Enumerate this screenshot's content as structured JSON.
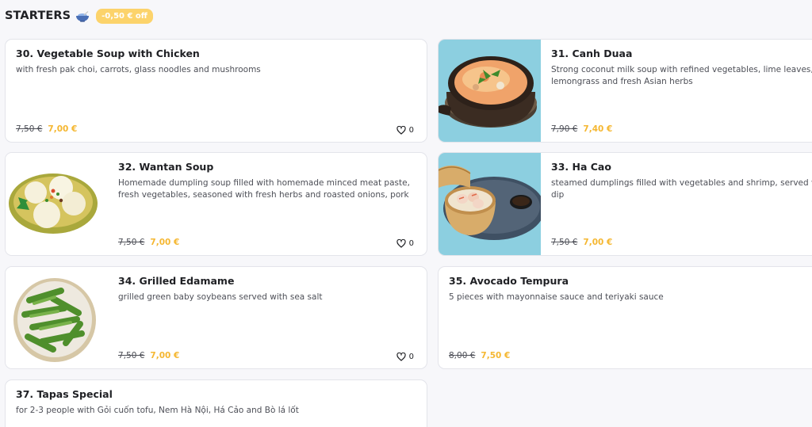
{
  "section": {
    "title": "STARTERS",
    "icon": "bowl-icon",
    "badge": "-0,50 € off"
  },
  "colors": {
    "accent": "#f5b731",
    "badge": "#fcd36b",
    "card_border": "#e3e4ea"
  },
  "items": [
    {
      "name": "30. Vegetable Soup with Chicken",
      "desc1": "with fresh pak choi, carrots, glass noodles and mushrooms",
      "desc2": "",
      "old_price": "7,50 €",
      "new_price": "7,00 €",
      "likes": "0",
      "image": ""
    },
    {
      "name": "31. Canh Duaa",
      "desc1": "Strong coconut milk soup with refined vegetables, lime leaves,",
      "desc2": "lemongrass and fresh Asian herbs",
      "old_price": "7,90 €",
      "new_price": "7,40 €",
      "likes": "",
      "image": "coconut soup in clay pot"
    },
    {
      "name": "32. Wantan Soup",
      "desc1": "Homemade dumpling soup filled with homemade minced meat paste,",
      "desc2": "fresh vegetables, seasoned with fresh herbs and roasted onions, pork",
      "old_price": "7,50 €",
      "new_price": "7,00 €",
      "likes": "0",
      "image": "wonton soup bowl"
    },
    {
      "name": "33. Ha Cao",
      "desc1": "steamed dumplings filled with vegetables and shrimp, served w",
      "desc2": "dip",
      "old_price": "7,50 €",
      "new_price": "7,00 €",
      "likes": "",
      "image": "dumplings in bamboo steamer"
    },
    {
      "name": "34. Grilled Edamame",
      "desc1": "grilled green baby soybeans served with sea salt",
      "desc2": "",
      "old_price": "7,50 €",
      "new_price": "7,00 €",
      "likes": "0",
      "image": "edamame bowl"
    },
    {
      "name": "35. Avocado Tempura",
      "desc1": "5 pieces with mayonnaise sauce and teriyaki sauce",
      "desc2": "",
      "old_price": "8,00 €",
      "new_price": "7,50 €",
      "likes": "",
      "image": ""
    },
    {
      "name": "37. Tapas Special",
      "desc1": "for 2-3 people with Gỏi cuốn tofu, Nem Hà Nội, Há Cảo and Bò lá lốt",
      "desc2": "",
      "old_price": "",
      "new_price": "",
      "likes": "",
      "image": ""
    }
  ]
}
